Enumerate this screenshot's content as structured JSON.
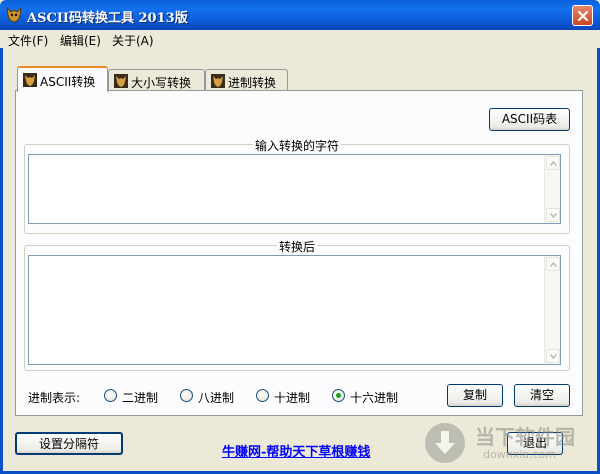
{
  "window": {
    "title": "ASCII码转换工具 2013版",
    "accent": "#0a5fd8"
  },
  "menu": [
    "文件(F)",
    "编辑(E)",
    "关于(A)"
  ],
  "tabs": [
    {
      "label": "ASCII转换",
      "active": true,
      "icon": "app-logo-icon"
    },
    {
      "label": "大小写转换",
      "active": false,
      "icon": "app-logo-icon"
    },
    {
      "label": "进制转换",
      "active": false,
      "icon": "app-logo-icon"
    }
  ],
  "panel": {
    "ascii_table_button": "ASCII码表",
    "input_group_label": "输入转换的字符",
    "input_value": "",
    "output_group_label": "转换后",
    "output_value": "",
    "radix_label": "进制表示:",
    "radix_options": [
      "二进制",
      "八进制",
      "十进制",
      "十六进制"
    ],
    "radix_selected": "十六进制",
    "copy_button": "复制",
    "clear_button": "清空"
  },
  "footer": {
    "separator_button": "设置分隔符",
    "link_text": "牛赚网-帮助天下草根赚钱",
    "exit_button": "退出"
  },
  "watermark": {
    "text": "当下软件园",
    "sub": "downxia.com"
  }
}
